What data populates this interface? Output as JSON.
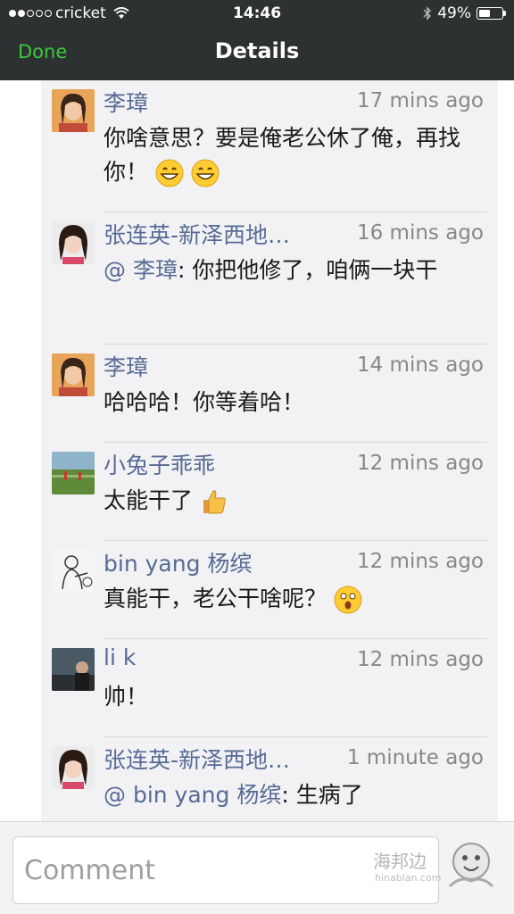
{
  "status_bar": {
    "carrier": "cricket",
    "time": "14:46",
    "battery": "49%"
  },
  "nav": {
    "done_label": "Done",
    "title": "Details"
  },
  "comments": [
    {
      "name": "李璋",
      "time": "17 mins ago",
      "text": "你啥意思？要是俺老公休了俺，再找你！",
      "avatar": "woman-portrait"
    },
    {
      "name": "张连英-新泽西地…",
      "time": "16 mins ago",
      "mention": "@ 李璋",
      "text": ": 你把他修了，咱俩一块干",
      "avatar": "woman-portrait-2"
    },
    {
      "name": "李璋",
      "time": "14 mins ago",
      "text": "哈哈哈！你等着哈！",
      "avatar": "woman-portrait"
    },
    {
      "name": "小兔子乖乖",
      "time": "12 mins ago",
      "text": "太能干了",
      "avatar": "field-photo"
    },
    {
      "name": "bin yang 杨缤",
      "time": "12 mins ago",
      "text": "真能干，老公干啥呢？",
      "avatar": "sketch-portrait"
    },
    {
      "name": "li k",
      "time": "12 mins ago",
      "text": "帅！",
      "avatar": "dark-photo"
    },
    {
      "name": "张连英-新泽西地…",
      "time": "1 minute ago",
      "mention": "@ bin yang 杨缤",
      "text": ": 生病了",
      "avatar": "woman-portrait-2"
    }
  ],
  "input": {
    "placeholder": "Comment"
  },
  "watermark": {
    "text": "海邦边",
    "sub": "hinabian.com"
  },
  "colors": {
    "nav_bg": "#2e3132",
    "done_green": "#3cc83c",
    "name_blue": "#576b95",
    "panel_bg": "#f2f2f5"
  }
}
